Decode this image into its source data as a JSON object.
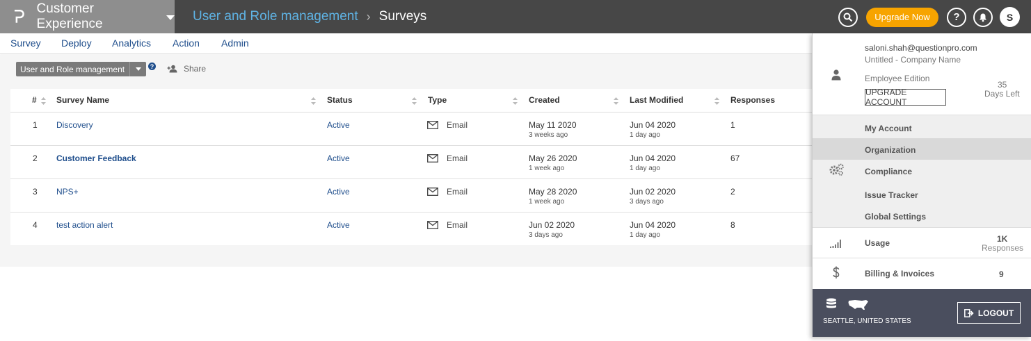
{
  "header": {
    "brand": "Customer Experience",
    "breadcrumb_link": "User and Role management",
    "breadcrumb_sep": "›",
    "breadcrumb_current": "Surveys",
    "upgrade_label": "Upgrade Now",
    "help_label": "?",
    "avatar_initial": "S",
    "brand_color": "#8e8e8e",
    "accent_color": "#f7a400"
  },
  "nav": {
    "items": [
      "Survey",
      "Deploy",
      "Analytics",
      "Action",
      "Admin"
    ]
  },
  "toolbar": {
    "dropdown_label": "User and Role management",
    "help_label": "?",
    "share_label": "Share"
  },
  "table": {
    "headers": [
      "#",
      "Survey Name",
      "Status",
      "Type",
      "Created",
      "Last Modified",
      "Responses"
    ],
    "rows": [
      {
        "num": "1",
        "name": "Discovery",
        "status": "Active",
        "type": "Email",
        "created": "May 11 2020",
        "created_ago": "3 weeks ago",
        "modified": "Jun 04 2020",
        "modified_ago": "1 day ago",
        "responses": "1"
      },
      {
        "num": "2",
        "name": "Customer Feedback",
        "status": "Active",
        "type": "Email",
        "created": "May 26 2020",
        "created_ago": "1 week ago",
        "modified": "Jun 04 2020",
        "modified_ago": "1 day ago",
        "responses": "67"
      },
      {
        "num": "3",
        "name": "NPS+",
        "status": "Active",
        "type": "Email",
        "created": "May 28 2020",
        "created_ago": "1 week ago",
        "modified": "Jun 02 2020",
        "modified_ago": "3 days ago",
        "responses": "2"
      },
      {
        "num": "4",
        "name": "test action alert",
        "status": "Active",
        "type": "Email",
        "created": "Jun 02 2020",
        "created_ago": "3 days ago",
        "modified": "Jun 04 2020",
        "modified_ago": "1 day ago",
        "responses": "8"
      }
    ]
  },
  "account_menu": {
    "email": "saloni.shah@questionpro.com",
    "company": "Untitled - Company Name",
    "edition": "Employee Edition",
    "upgrade_account": "UPGRADE ACCOUNT",
    "days_number": "35",
    "days_label": "Days Left",
    "items": [
      "My Account",
      "Organization",
      "Compliance",
      "Issue Tracker",
      "Global Settings"
    ],
    "active_item": "Organization",
    "usage_label": "Usage",
    "usage_value": "1K",
    "usage_unit": "Responses",
    "billing_label": "Billing & Invoices",
    "billing_value": "9",
    "location": "SEATTLE, UNITED STATES",
    "logout_label": "LOGOUT"
  },
  "icons": {
    "search": "search-icon",
    "help": "help-icon",
    "bell": "bell-icon",
    "user": "user-icon",
    "gears": "gears-icon",
    "signal": "signal-icon",
    "dollar": "dollar-icon",
    "database": "database-icon",
    "map": "usa-map-icon",
    "logout": "logout-icon",
    "email": "envelope-icon"
  }
}
